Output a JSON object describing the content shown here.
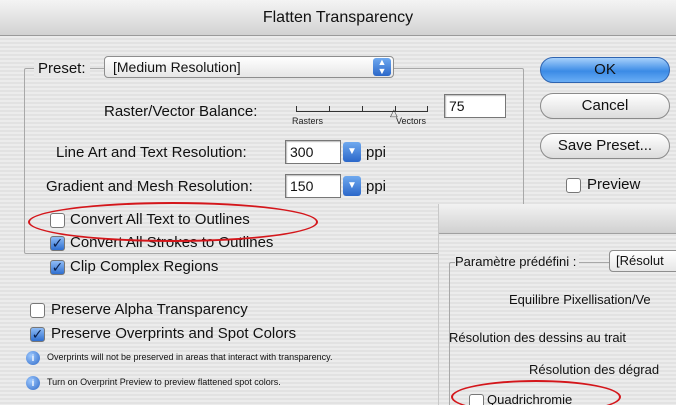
{
  "window": {
    "title": "Flatten Transparency"
  },
  "preset": {
    "label": "Preset:",
    "value": "[Medium Resolution]"
  },
  "raster_vector": {
    "label": "Raster/Vector Balance:",
    "left_label": "Rasters",
    "right_label": "Vectors",
    "value": "75"
  },
  "line_art": {
    "label": "Line Art and Text Resolution:",
    "value": "300",
    "unit": "ppi"
  },
  "gradient_mesh": {
    "label": "Gradient and Mesh Resolution:",
    "value": "150",
    "unit": "ppi"
  },
  "checkboxes": {
    "convert_text": {
      "label": "Convert All Text to Outlines",
      "checked": false
    },
    "convert_strokes": {
      "label": "Convert All Strokes to Outlines",
      "checked": true
    },
    "clip_complex": {
      "label": "Clip Complex Regions",
      "checked": true
    },
    "preserve_alpha": {
      "label": "Preserve Alpha Transparency",
      "checked": false
    },
    "preserve_overprints": {
      "label": "Preserve Overprints and Spot Colors",
      "checked": true
    }
  },
  "notes": {
    "overprints": "Overprints will not be preserved in areas that interact with transparency.",
    "overprint_preview": "Turn on Overprint Preview to preview flattened spot colors."
  },
  "buttons": {
    "ok": "OK",
    "cancel": "Cancel",
    "save_preset": "Save Preset..."
  },
  "preview": {
    "label": "Preview",
    "checked": false
  },
  "overlay": {
    "preset_label": "Paramètre prédéfini :",
    "preset_value": "[Résolut",
    "balance_label": "Equilibre Pixellisation/Ve",
    "line_art_label": "Résolution des dessins au trait",
    "gradient_label": "Résolution des dégrad",
    "checkbox_label": "Quadrichromie"
  },
  "colors": {
    "accent": "#3b8be6",
    "highlight_ellipse": "#d4161b"
  }
}
